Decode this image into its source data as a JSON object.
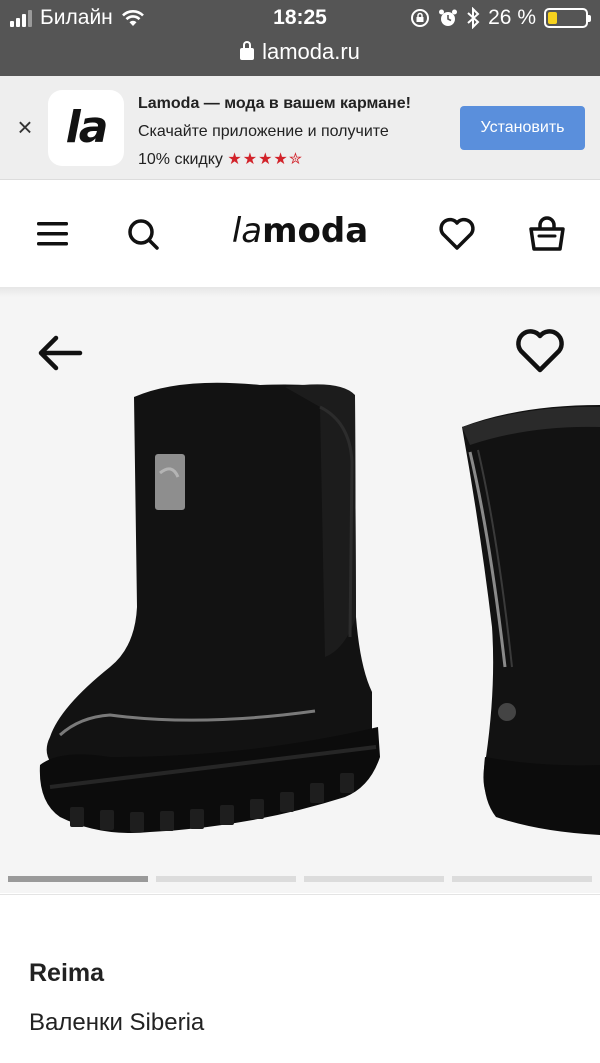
{
  "status_bar": {
    "carrier": "Билайн",
    "time": "18:25",
    "battery_percent": "26 %",
    "battery_level": 0.26,
    "icons": [
      "signal-icon",
      "wifi-icon",
      "rotation-lock-icon",
      "alarm-icon",
      "bluetooth-icon",
      "battery-icon"
    ]
  },
  "browser": {
    "url": "lamoda.ru"
  },
  "app_banner": {
    "app_logo": "la",
    "title": "Lamoda — мода в вашем кармане!",
    "line2": "Скачайте приложение и получите",
    "line3": "10% скидку",
    "stars": "★★★★✮",
    "rating": 4.5,
    "install_label": "Установить",
    "close_symbol": "×",
    "colors": {
      "button": "#5a8fdc",
      "stars": "#d2232a"
    }
  },
  "header": {
    "logo_prefix": "la",
    "logo_rest": "moda",
    "icons": [
      "menu-icon",
      "search-icon",
      "heart-icon",
      "cart-icon"
    ]
  },
  "gallery": {
    "slides_total": 4,
    "active_slide": 1,
    "icons": [
      "back-arrow-icon",
      "favorite-heart-icon"
    ]
  },
  "product": {
    "brand": "Reima",
    "name": "Валенки Siberia"
  }
}
